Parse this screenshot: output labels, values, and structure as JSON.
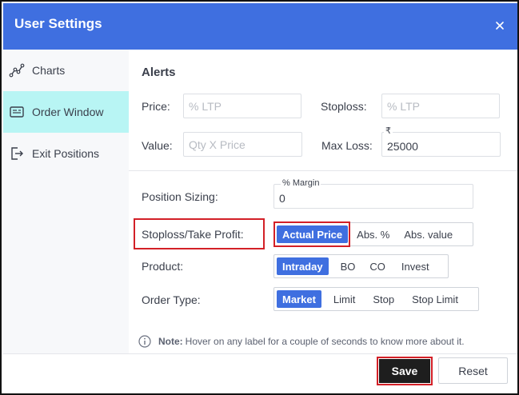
{
  "window": {
    "title": "User Settings"
  },
  "sidebar": {
    "items": [
      {
        "label": "Charts",
        "icon": "chart-line-icon"
      },
      {
        "label": "Order Window",
        "icon": "order-window-icon",
        "active": true
      },
      {
        "label": "Exit Positions",
        "icon": "exit-icon"
      }
    ]
  },
  "alerts": {
    "title": "Alerts",
    "price_label": "Price:",
    "price_placeholder": "% LTP",
    "stoploss_label": "Stoploss:",
    "stoploss_placeholder": "% LTP",
    "value_label": "Value:",
    "value_placeholder": "Qty X Price",
    "maxloss_label": "Max Loss:",
    "maxloss_currency": "₹",
    "maxloss_value": "25000"
  },
  "position_sizing": {
    "label": "Position Sizing:",
    "field_label": "% Margin",
    "value": "0"
  },
  "stoploss_take_profit": {
    "label": "Stoploss/Take Profit:",
    "options": [
      "Actual Price",
      "Abs. %",
      "Abs. value"
    ],
    "selected": "Actual Price"
  },
  "product": {
    "label": "Product:",
    "options": [
      "Intraday",
      "BO",
      "CO",
      "Invest"
    ],
    "selected": "Intraday"
  },
  "order_type": {
    "label": "Order Type:",
    "options": [
      "Market",
      "Limit",
      "Stop",
      "Stop Limit"
    ],
    "selected": "Market"
  },
  "note": {
    "prefix": "Note:",
    "text": "Hover on any label for a couple of seconds to know more about it."
  },
  "footer": {
    "save_label": "Save",
    "reset_label": "Reset"
  },
  "colors": {
    "accent": "#3f6fe0",
    "active_sidebar": "#b8f5f4",
    "highlight": "#d32027",
    "save_bg": "#1e1e1e"
  }
}
